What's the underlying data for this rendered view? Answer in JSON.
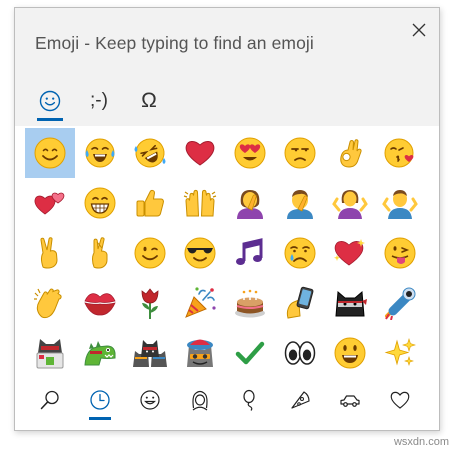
{
  "window": {
    "title": "Emoji - Keep typing to find an emoji",
    "close_icon": "close-icon"
  },
  "tabs": [
    {
      "icon": "smiley-face-icon",
      "label": "",
      "selected": true
    },
    {
      "icon": "kaomoji",
      "label": ";-)",
      "selected": false
    },
    {
      "icon": "symbols",
      "label": "Ω",
      "selected": false
    }
  ],
  "emoji_grid": [
    [
      "smiling-face",
      "tears-of-joy",
      "rolling-on-floor-laughing",
      "red-heart",
      "heart-eyes",
      "unamused",
      "ok-hand",
      "face-blowing-kiss"
    ],
    [
      "two-hearts",
      "grinning-face",
      "thumbs-up",
      "raising-hands",
      "woman-facepalming",
      "man-facepalming",
      "woman-shrugging",
      "man-shrugging"
    ],
    [
      "victory-hand",
      "crossed-fingers",
      "winking-face",
      "sunglasses-face",
      "musical-notes",
      "crying-face",
      "sparkling-heart",
      "winking-tongue"
    ],
    [
      "clapping-hands",
      "kiss-mark",
      "rose",
      "party-popper",
      "birthday-cake",
      "selfie",
      "ninja-cat",
      "astronaut-ninja-cat"
    ],
    [
      "hacker-cat",
      "dino-cat",
      "stack-of-ninja-cats",
      "hipster-cat",
      "check-mark",
      "eyes",
      "grinning-face-big-eyes",
      "sparkles"
    ]
  ],
  "selected_emoji": "smiling-face",
  "categories": [
    {
      "icon": "search-icon",
      "selected": false
    },
    {
      "icon": "recent-clock-icon",
      "selected": true
    },
    {
      "icon": "smiley-outline-icon",
      "selected": false
    },
    {
      "icon": "person-icon",
      "selected": false
    },
    {
      "icon": "balloon-icon",
      "selected": false
    },
    {
      "icon": "pizza-icon",
      "selected": false
    },
    {
      "icon": "car-icon",
      "selected": false
    },
    {
      "icon": "heart-outline-icon",
      "selected": false
    }
  ],
  "watermark": "wsxdn.com",
  "colors": {
    "accent": "#0063b1",
    "selection": "#a8cdf0",
    "header_bg": "#f2f2f2"
  }
}
